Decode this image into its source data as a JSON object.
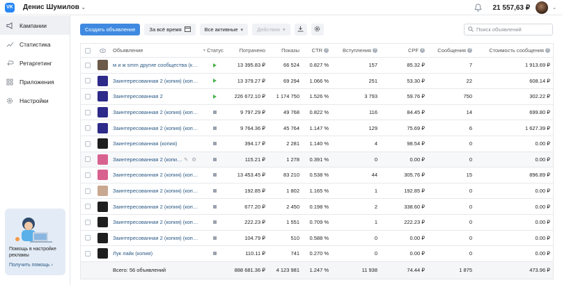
{
  "topbar": {
    "logo": "VK",
    "account_name": "Денис Шумилов",
    "balance": "21 557,63 ₽",
    "icons": {
      "bell": "bell-icon",
      "avatar": "avatar",
      "chevron": "chevron-down-icon"
    }
  },
  "sidebar": {
    "items": [
      {
        "label": "Кампании",
        "icon": "megaphone-icon",
        "active": true
      },
      {
        "label": "Статистика",
        "icon": "chart-line-icon",
        "active": false
      },
      {
        "label": "Ретаргетинг",
        "icon": "retarget-icon",
        "active": false
      },
      {
        "label": "Приложения",
        "icon": "apps-grid-icon",
        "active": false
      },
      {
        "label": "Настройки",
        "icon": "gear-icon",
        "active": false
      }
    ],
    "help": {
      "text": "Помощь в настройке рекламы",
      "link": "Получить помощь",
      "link_arrow": "›"
    }
  },
  "toolbar": {
    "create_label": "Создать объявление",
    "period_label": "За всё время",
    "filter_label": "Все активные",
    "actions_label": "Действия",
    "search_placeholder": "Поиск объявлений"
  },
  "table": {
    "headers": {
      "name": "Объявление",
      "status": "Статус",
      "spent": "Потрачено",
      "impressions": "Показы",
      "ctr": "CTR",
      "joins": "Вступления",
      "cpf": "CPF",
      "messages": "Сообщения",
      "msg_cost": "Стоимость сообщения"
    },
    "rows": [
      {
        "name": "м и ж smm другие сообщества (копия)",
        "status": "active",
        "spent": "13 395.83 ₽",
        "impressions": "66 524",
        "ctr": "0.827 %",
        "joins": "157",
        "cpf": "85.32 ₽",
        "messages": "7",
        "msg_cost": "1 913.69 ₽",
        "thumb": "#6b5a4a"
      },
      {
        "name": "Заинтересованная 2 (копия) (копия)",
        "status": "active",
        "spent": "13 379.27 ₽",
        "impressions": "69 294",
        "ctr": "1.066 %",
        "joins": "251",
        "cpf": "53.30 ₽",
        "messages": "22",
        "msg_cost": "608.14 ₽",
        "thumb": "#2d2a8a"
      },
      {
        "name": "Заинтересованная 2",
        "status": "active",
        "spent": "226 672.10 ₽",
        "impressions": "1 174 750",
        "ctr": "1.526 %",
        "joins": "3 793",
        "cpf": "59.76 ₽",
        "messages": "750",
        "msg_cost": "302.22 ₽",
        "thumb": "#2d2a8a"
      },
      {
        "name": "Заинтересованная 2 (копия) (копия)",
        "status": "stopped",
        "spent": "9 797.29 ₽",
        "impressions": "49 768",
        "ctr": "0.822 %",
        "joins": "116",
        "cpf": "84.45 ₽",
        "messages": "14",
        "msg_cost": "699.80 ₽",
        "thumb": "#2d2a8a"
      },
      {
        "name": "Заинтересованная 2 (копия) (копия)",
        "status": "stopped",
        "spent": "9 764.36 ₽",
        "impressions": "45 764",
        "ctr": "1.147 %",
        "joins": "129",
        "cpf": "75.69 ₽",
        "messages": "6",
        "msg_cost": "1 627.39 ₽",
        "thumb": "#2d2a8a"
      },
      {
        "name": "Заинтересованная (копия)",
        "status": "stopped",
        "spent": "394.17 ₽",
        "impressions": "2 281",
        "ctr": "1.140 %",
        "joins": "4",
        "cpf": "98.54 ₽",
        "messages": "0",
        "msg_cost": "0.00 ₽",
        "thumb": "#1e1e1e"
      },
      {
        "name": "Заинтересованная 2 (копия) (копия)",
        "status": "stopped",
        "spent": "115.21 ₽",
        "impressions": "1 278",
        "ctr": "0.391 %",
        "joins": "0",
        "cpf": "0.00 ₽",
        "messages": "0",
        "msg_cost": "0.00 ₽",
        "thumb": "#d8628f",
        "hover": true
      },
      {
        "name": "Заинтересованная 2 (копия) (копия)",
        "status": "stopped",
        "spent": "13 453.45 ₽",
        "impressions": "83 210",
        "ctr": "0.538 %",
        "joins": "44",
        "cpf": "305.76 ₽",
        "messages": "15",
        "msg_cost": "896.89 ₽",
        "thumb": "#d8628f"
      },
      {
        "name": "Заинтересованная 2 (копия) (копия)",
        "status": "stopped",
        "spent": "192.85 ₽",
        "impressions": "1 802",
        "ctr": "1.165 %",
        "joins": "1",
        "cpf": "192.85 ₽",
        "messages": "0",
        "msg_cost": "0.00 ₽",
        "thumb": "#c9a892"
      },
      {
        "name": "Заинтересованная 2 (копия) (копия)",
        "status": "stopped",
        "spent": "677.20 ₽",
        "impressions": "2 450",
        "ctr": "0.198 %",
        "joins": "2",
        "cpf": "338.60 ₽",
        "messages": "0",
        "msg_cost": "0.00 ₽",
        "thumb": "#1e1e1e"
      },
      {
        "name": "Заинтересованная 2 (копия) (копия)",
        "status": "stopped",
        "spent": "222.23 ₽",
        "impressions": "1 551",
        "ctr": "0.709 %",
        "joins": "1",
        "cpf": "222.23 ₽",
        "messages": "0",
        "msg_cost": "0.00 ₽",
        "thumb": "#1e1e1e"
      },
      {
        "name": "Заинтересованная 2 (копия) (копия)",
        "status": "stopped",
        "spent": "104.79 ₽",
        "impressions": "510",
        "ctr": "0.588 %",
        "joins": "0",
        "cpf": "0.00 ₽",
        "messages": "0",
        "msg_cost": "0.00 ₽",
        "thumb": "#1e1e1e"
      },
      {
        "name": "Лук лайк (копия)",
        "status": "stopped",
        "spent": "110.11 ₽",
        "impressions": "741",
        "ctr": "0.270 %",
        "joins": "0",
        "cpf": "0.00 ₽",
        "messages": "0",
        "msg_cost": "0.00 ₽",
        "thumb": "#1e1e1e"
      }
    ],
    "footer": {
      "total_label": "Всего: 56 объявлений",
      "spent": "888 681.36 ₽",
      "impressions": "4 123 981",
      "ctr": "1.247 %",
      "joins": "11 938",
      "cpf": "74.44 ₽",
      "messages": "1 875",
      "msg_cost": "473.96 ₽"
    }
  }
}
